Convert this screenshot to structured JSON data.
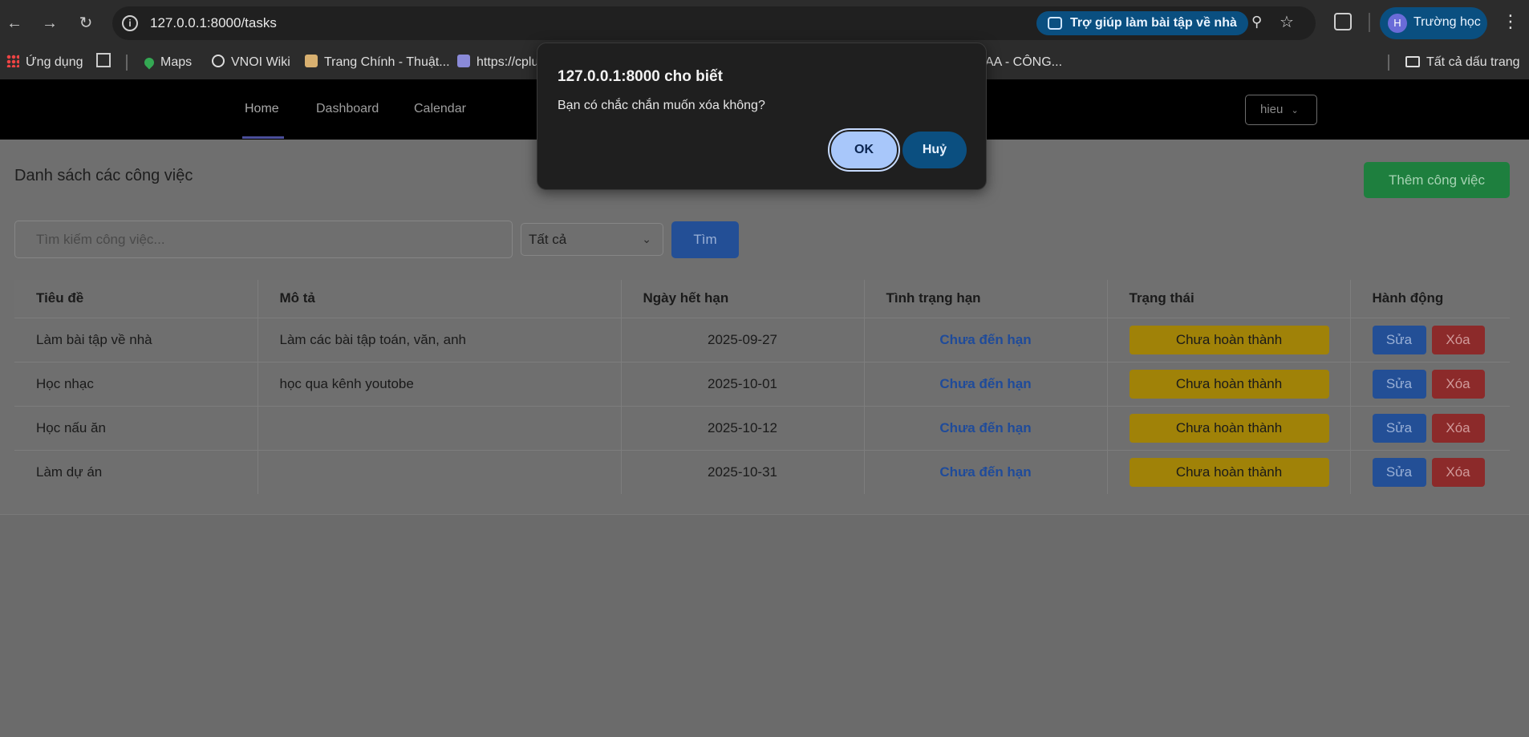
{
  "browser": {
    "url": "127.0.0.1:8000/tasks",
    "chip_label": "Trợ giúp làm bài tập về nhà",
    "profile_initial": "H",
    "profile_name": "Trường học"
  },
  "bookmarks": {
    "items": [
      "Ứng dụng",
      "Maps",
      "VNOI Wiki",
      "Trang Chính - Thuật...",
      "https://cplu",
      "AA - CÔNG..."
    ],
    "all_bookmarks": "Tất cả dấu trang"
  },
  "nav": {
    "links": [
      "Home",
      "Dashboard",
      "Calendar"
    ],
    "user": "hieu"
  },
  "main": {
    "title": "Danh sách các công việc",
    "add_button": "Thêm công việc",
    "search_placeholder": "Tìm kiếm công việc...",
    "filter_value": "Tất cả",
    "find_button": "Tìm"
  },
  "table": {
    "headers": [
      "Tiêu đề",
      "Mô tả",
      "Ngày hết hạn",
      "Tình trạng hạn",
      "Trạng thái",
      "Hành động"
    ],
    "rows": [
      {
        "title": "Làm bài tập về nhà",
        "desc": "Làm các bài tập toán, văn, anh",
        "due": "2025-09-27",
        "deadline": "Chưa đến hạn",
        "status": "Chưa hoàn thành"
      },
      {
        "title": "Học nhạc",
        "desc": "học qua kênh youtobe",
        "due": "2025-10-01",
        "deadline": "Chưa đến hạn",
        "status": "Chưa hoàn thành"
      },
      {
        "title": "Học nấu ăn",
        "desc": "",
        "due": "2025-10-12",
        "deadline": "Chưa đến hạn",
        "status": "Chưa hoàn thành"
      },
      {
        "title": "Làm dự án",
        "desc": "",
        "due": "2025-10-31",
        "deadline": "Chưa đến hạn",
        "status": "Chưa hoàn thành"
      }
    ],
    "edit_label": "Sửa",
    "delete_label": "Xóa"
  },
  "dialog": {
    "title": "127.0.0.1:8000 cho biết",
    "message": "Bạn có chắc chắn muốn xóa không?",
    "ok": "OK",
    "cancel": "Huỷ"
  },
  "colors": {
    "status_badge": "#ffce00",
    "add_button": "#198754",
    "primary": "#0d6efd",
    "danger": "#dc3545",
    "dialog_ok": "#a8c7fa"
  }
}
